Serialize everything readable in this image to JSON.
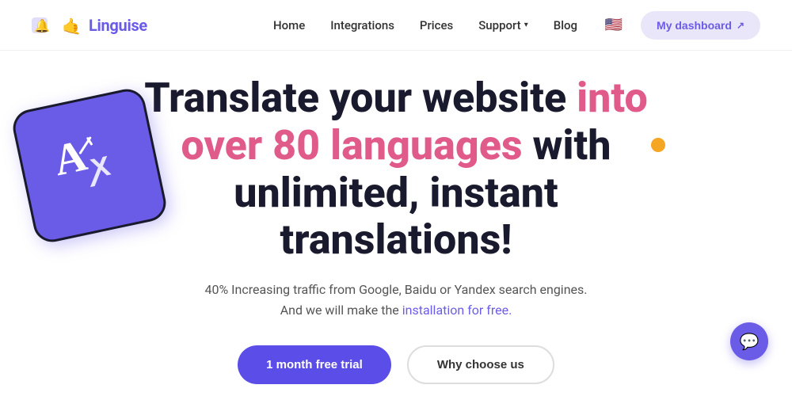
{
  "navbar": {
    "logo_text": "Linguise",
    "nav_items": [
      {
        "label": "Home",
        "id": "home"
      },
      {
        "label": "Integrations",
        "id": "integrations"
      },
      {
        "label": "Prices",
        "id": "prices"
      },
      {
        "label": "Support",
        "id": "support",
        "has_dropdown": true
      },
      {
        "label": "Blog",
        "id": "blog"
      }
    ],
    "flag_emoji": "🇺🇸",
    "dashboard_label": "My dashboard",
    "dashboard_ext_icon": "↗"
  },
  "hero": {
    "title_part1": "Translate your website ",
    "title_highlight": "into over 80 languages",
    "title_part2": " with unlimited, instant translations!",
    "subtitle_line1": "40% Increasing traffic from Google, Baidu or Yandex search engines.",
    "subtitle_line2": "And we will make the ",
    "subtitle_link": "installation for free.",
    "btn_primary": "1 month free trial",
    "btn_secondary": "Why choose us"
  },
  "decorations": {
    "translate_icon": "A↔",
    "orange_dot_color": "#f5a623",
    "chat_icon": "💬"
  },
  "colors": {
    "brand_purple": "#6b5ce7",
    "highlight_pink": "#e05a8a",
    "dark_text": "#1a1a2e",
    "link_color": "#6b5ce7"
  }
}
